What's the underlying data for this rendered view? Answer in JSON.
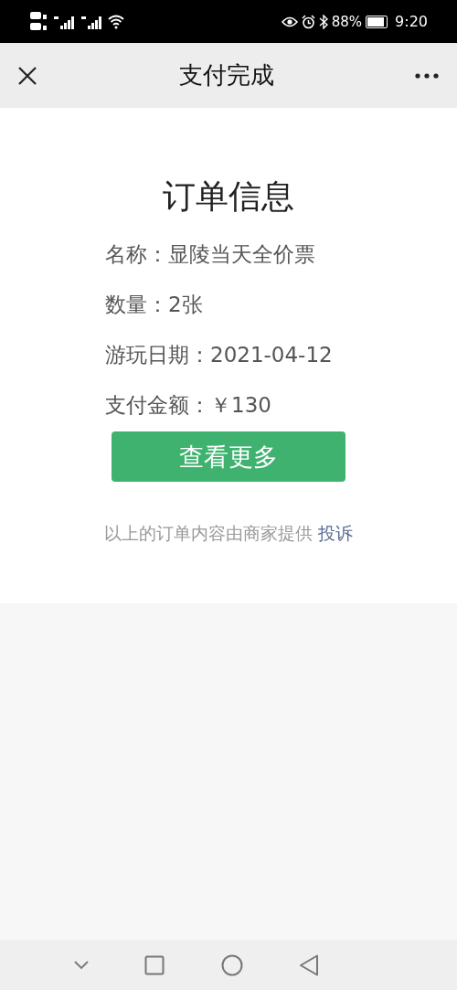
{
  "status_bar": {
    "battery": "88%",
    "time": "9:20"
  },
  "nav": {
    "title": "支付完成"
  },
  "order": {
    "heading": "订单信息",
    "fields": [
      {
        "label": "名称：",
        "value": "显陵当天全价票"
      },
      {
        "label": "数量：",
        "value": "2张"
      },
      {
        "label": "游玩日期：",
        "value": "2021-04-12"
      },
      {
        "label": "支付金额：",
        "value": "￥130"
      }
    ],
    "button": "查看更多",
    "footer": {
      "text": "以上的订单内容由商家提供",
      "link": "投诉"
    }
  }
}
